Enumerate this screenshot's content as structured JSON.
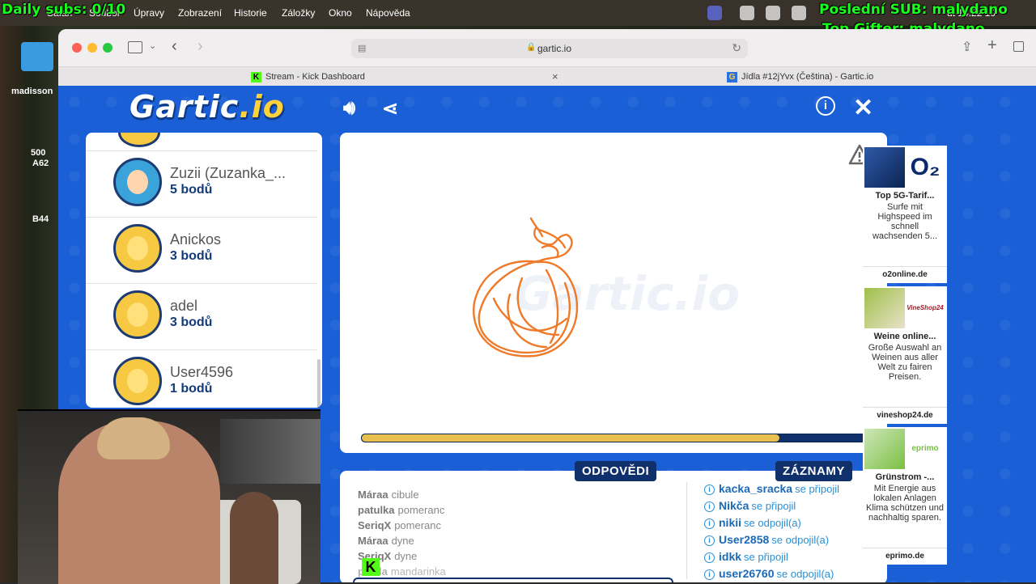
{
  "overlay": {
    "daily_subs": "Daily subs: 0/10",
    "last_sub": "Poslední SUB: malydano",
    "top_gifter": "Top Gifter: malydano"
  },
  "menubar": {
    "items": [
      "Safari",
      "Soubor",
      "Úpravy",
      "Zobrazení",
      "Historie",
      "Záložky",
      "Okno",
      "Nápověda"
    ],
    "clock": "út 14:22 10"
  },
  "desktop": {
    "label1": "madisson",
    "label2": "500",
    "label3": "A62",
    "label4": "B44"
  },
  "browser": {
    "url": "gartic.io",
    "tabs": [
      {
        "label": "Stream - Kick Dashboard",
        "icon": "kick-icon"
      },
      {
        "label": "Jídla #12jYvx (Čeština) - Gartic.io",
        "icon": "gartic-icon"
      }
    ]
  },
  "game": {
    "logo": "Gartic",
    "logo_suffix": ".io",
    "watermark": "Gartic.io",
    "players": [
      {
        "name": "Zuzii (Zuzanka_...",
        "score": "5 bodů",
        "avatar": "girl"
      },
      {
        "name": "Anickos",
        "score": "3 bodů",
        "avatar": "default"
      },
      {
        "name": "adel",
        "score": "3 bodů",
        "avatar": "default"
      },
      {
        "name": "User4596",
        "score": "1 bodů",
        "avatar": "default"
      }
    ],
    "timer_progress": 0.83,
    "answers_label": "ODPOVĚDI",
    "log_label": "ZÁZNAMY",
    "answers": [
      {
        "user": "Máraa",
        "text": "cibule"
      },
      {
        "user": "patulka",
        "text": "pomeranc"
      },
      {
        "user": "SeriqX",
        "text": "pomeranc"
      },
      {
        "user": "Máraa",
        "text": "dyne"
      },
      {
        "user": "SeriqX",
        "text": "dyne"
      },
      {
        "user": "pa...la",
        "text": "mandarinka"
      }
    ],
    "log": [
      {
        "user": "kacka_sracka",
        "action": "se připojil"
      },
      {
        "user": "Nikča",
        "action": "se připojil"
      },
      {
        "user": "nikii",
        "action": "se odpojil(a)"
      },
      {
        "user": "User2858",
        "action": "se odpojil(a)"
      },
      {
        "user": "idkk",
        "action": "se připojil"
      },
      {
        "user": "user26760",
        "action": "se odpojil(a)"
      }
    ]
  },
  "ads": [
    {
      "brand": "O₂",
      "title": "Top 5G-Tarif...",
      "body": "Surfe mit Highspeed im schnell wachsenden 5...",
      "domain": "o2online.de",
      "color": "#0a2a6c"
    },
    {
      "brand": "VineShop24",
      "title": "Weine online...",
      "body": "Große Auswahl an Weinen aus aller Welt zu fairen Preisen.",
      "domain": "vineshop24.de",
      "color": "#a0202a"
    },
    {
      "brand": "eprimo",
      "title": "Grünstrom -...",
      "body": "Mit Energie aus lokalen Anlagen Klima schützen und nachhaltig sparen.",
      "domain": "eprimo.de",
      "color": "#7ac043"
    }
  ]
}
